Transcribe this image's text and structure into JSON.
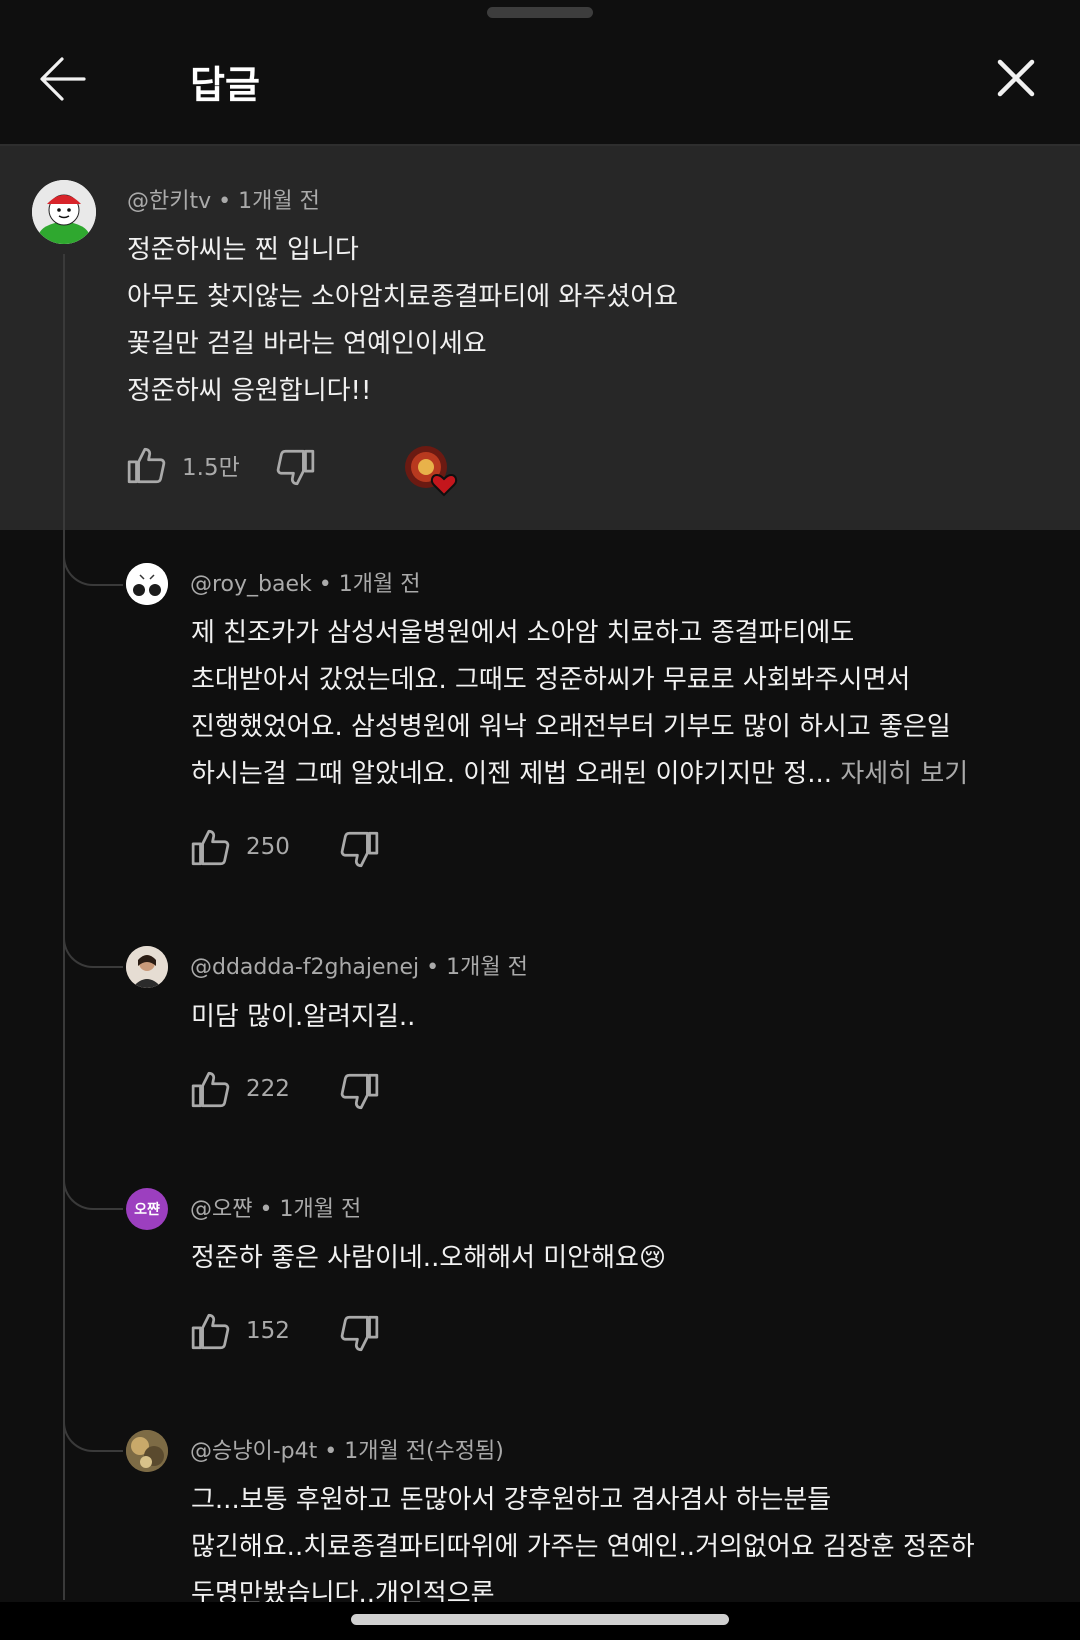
{
  "header": {
    "title": "답글"
  },
  "parent": {
    "handle": "@한키tv",
    "time": "1개월 전",
    "lines": [
      "정준하씨는 찐 입니다",
      "아무도 찾지않는 소아암치료종결파티에 와주셨어요",
      "꽃길만 걷길 바라는 연예인이세요",
      "정준하씨 응원합니다!!"
    ],
    "likes": "1.5만"
  },
  "replies": [
    {
      "handle": "@roy_baek",
      "time": "1개월 전",
      "lines": [
        "제 친조카가 삼성서울병원에서 소아암 치료하고 종결파티에도",
        "초대받아서 갔었는데요. 그때도 정준하씨가 무료로 사회봐주시면서",
        "진행했었어요. 삼성병원에 워낙 오래전부터 기부도 많이 하시고 좋은일",
        "하시는걸 그때 알았네요. 이젠 제법 오래된 이야기지만 정..."
      ],
      "read_more": "자세히 보기",
      "likes": "250"
    },
    {
      "handle": "@ddadda-f2ghajenej",
      "time": "1개월 전",
      "lines": [
        "미담 많이.알려지길.."
      ],
      "likes": "222"
    },
    {
      "handle": "@오쨘",
      "avatar_text": "오쨘",
      "time": "1개월 전",
      "lines": [
        "정준하 좋은 사람이네..오해해서 미안해요😢"
      ],
      "likes": "152"
    },
    {
      "handle": "@승냥이-p4t",
      "time": "1개월 전(수정됨)",
      "lines": [
        "그...보통 후원하고 돈많아서 걍후원하고 겸사겸사 하는분들",
        "많긴해요..치료종결파티따위에 가주는 연예인..거의없어요 김장훈 정준하",
        "두명만봤습니다..개인적으론"
      ]
    }
  ],
  "icons": {
    "back": "arrow-left-icon",
    "close": "close-icon",
    "like": "thumbs-up-icon",
    "dislike": "thumbs-down-icon"
  },
  "colors": {
    "background": "#0f0f0f",
    "highlight": "#272727",
    "meta_text": "#aaaaaa",
    "avatar_purple": "#9c3fbf"
  }
}
